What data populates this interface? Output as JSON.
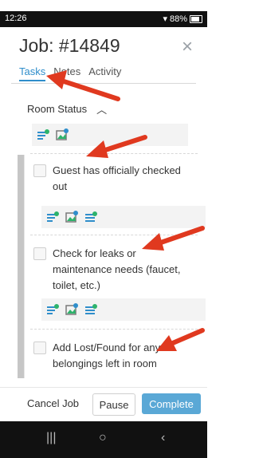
{
  "status_bar": {
    "time": "12:26",
    "battery": "88%"
  },
  "header": {
    "title": "Job: #14849",
    "close_glyph": "×"
  },
  "tabs": [
    {
      "label": "Tasks"
    },
    {
      "label": "Notes"
    },
    {
      "label": "Activity"
    }
  ],
  "section": {
    "label": "Room Status"
  },
  "tasks": [
    {
      "text": "Guest has officially checked out"
    },
    {
      "text": "Check for leaks or maintenance needs (faucet, toilet, etc.)"
    },
    {
      "text": "Add Lost/Found for any belongings left in room"
    }
  ],
  "footer": {
    "cancel": "Cancel Job",
    "pause": "Pause",
    "complete": "Complete"
  },
  "icons": [
    "add-note-icon",
    "add-image-icon",
    "add-checklist-icon"
  ],
  "colors": {
    "accent": "#2f8ecb",
    "complete_button": "#5aa8d6",
    "annotation_arrow": "#e0391f"
  }
}
